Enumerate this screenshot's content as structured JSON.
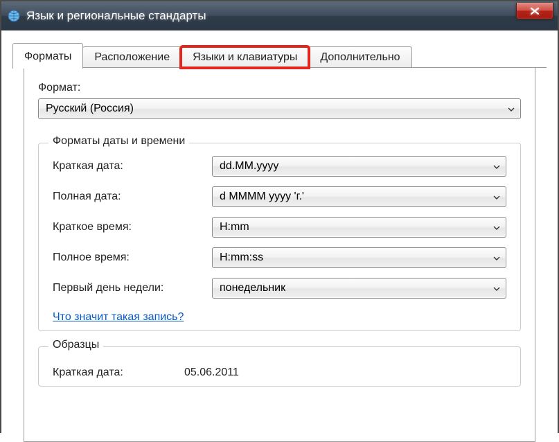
{
  "window": {
    "title": "Язык и региональные стандарты"
  },
  "tabs": [
    {
      "label": "Форматы",
      "active": true
    },
    {
      "label": "Расположение",
      "active": false
    },
    {
      "label": "Языки и клавиатуры",
      "active": false,
      "highlight": true
    },
    {
      "label": "Дополнительно",
      "active": false
    }
  ],
  "format": {
    "label": "Формат:",
    "value": "Русский (Россия)"
  },
  "datetime_formats": {
    "legend": "Форматы даты и времени",
    "rows": [
      {
        "label": "Краткая дата:",
        "value": "dd.MM.yyyy"
      },
      {
        "label": "Полная дата:",
        "value": "d MMMM yyyy 'г.'"
      },
      {
        "label": "Краткое время:",
        "value": "H:mm"
      },
      {
        "label": "Полное время:",
        "value": "H:mm:ss"
      },
      {
        "label": "Первый день недели:",
        "value": "понедельник"
      }
    ],
    "help_link": "Что значит такая запись?"
  },
  "samples": {
    "legend": "Образцы",
    "rows": [
      {
        "label": "Краткая дата:",
        "value": "05.06.2011"
      }
    ]
  }
}
